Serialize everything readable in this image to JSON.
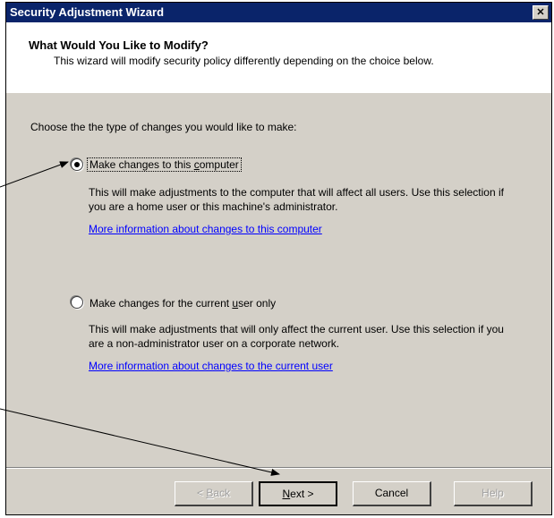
{
  "window": {
    "title": "Security Adjustment Wizard",
    "close_glyph": "✕"
  },
  "header": {
    "title": "What Would You Like to Modify?",
    "description": "This wizard will modify security policy differently depending on the choice below."
  },
  "prompt": "Choose the the type of changes you would like to make:",
  "options": [
    {
      "label_pre": "Make changes to this ",
      "label_underlined": "c",
      "label_post": "omputer",
      "selected": true,
      "description": "This will make adjustments to the computer that will affect all users.  Use this selection if you are a home user or this machine's administrator.",
      "link": "More information about changes to this computer"
    },
    {
      "label_pre": "Make changes for the current ",
      "label_underlined": "u",
      "label_post": "ser only",
      "selected": false,
      "description": "This will make adjustments that will only affect the current user.  Use this selection if you are a non-administrator user on a corporate network.",
      "link": "More information about changes to the current user"
    }
  ],
  "buttons": {
    "back_pre": "< ",
    "back_u": "B",
    "back_post": "ack",
    "next_u": "N",
    "next_post": "ext >",
    "cancel": "Cancel",
    "help": "Help"
  },
  "colors": {
    "titlebar": "#0a246a",
    "link": "#0000ff",
    "dialog_bg": "#d4d0c8"
  }
}
